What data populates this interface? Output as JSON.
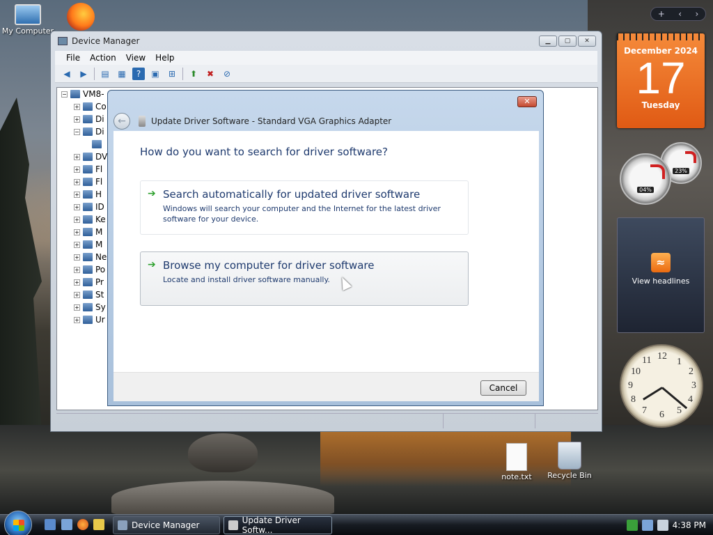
{
  "desktop": {
    "icons": [
      {
        "label": "My Computer"
      },
      {
        "label": ""
      },
      {
        "label": "note.txt"
      },
      {
        "label": "Recycle Bin"
      }
    ]
  },
  "device_manager": {
    "title": "Device Manager",
    "menu": [
      "File",
      "Action",
      "View",
      "Help"
    ],
    "tree": {
      "root": "VM8-",
      "items": [
        "Co",
        "Di",
        "Di",
        "",
        "DV",
        "Fl",
        "Fl",
        "H",
        "ID",
        "Ke",
        "M",
        "M",
        "Ne",
        "Po",
        "Pr",
        "St",
        "Sy",
        "Ur"
      ]
    }
  },
  "dialog": {
    "title": "Update Driver Software - Standard VGA Graphics Adapter",
    "close_label": "✕",
    "question": "How do you want to search for driver software?",
    "options": [
      {
        "title": "Search automatically for updated driver software",
        "description": "Windows will search your computer and the Internet for the latest driver software for your device."
      },
      {
        "title": "Browse my computer for driver software",
        "description": "Locate and install driver software manually."
      }
    ],
    "cancel_label": "Cancel"
  },
  "sidebar": {
    "controls": [
      "+",
      "‹",
      "›"
    ],
    "calendar": {
      "month_year": "December 2024",
      "day": "17",
      "weekday": "Tuesday"
    },
    "cpu_meter": {
      "cpu": "04%",
      "ram": "23%"
    },
    "feed_label": "View headlines"
  },
  "taskbar": {
    "buttons": [
      {
        "label": "Device Manager"
      },
      {
        "label": "Update Driver Softw..."
      }
    ],
    "clock": "4:38 PM"
  },
  "colors": {
    "accent": "#1e3a6e",
    "calendar": "#e86a20",
    "arrow_green": "#2ca02c"
  }
}
